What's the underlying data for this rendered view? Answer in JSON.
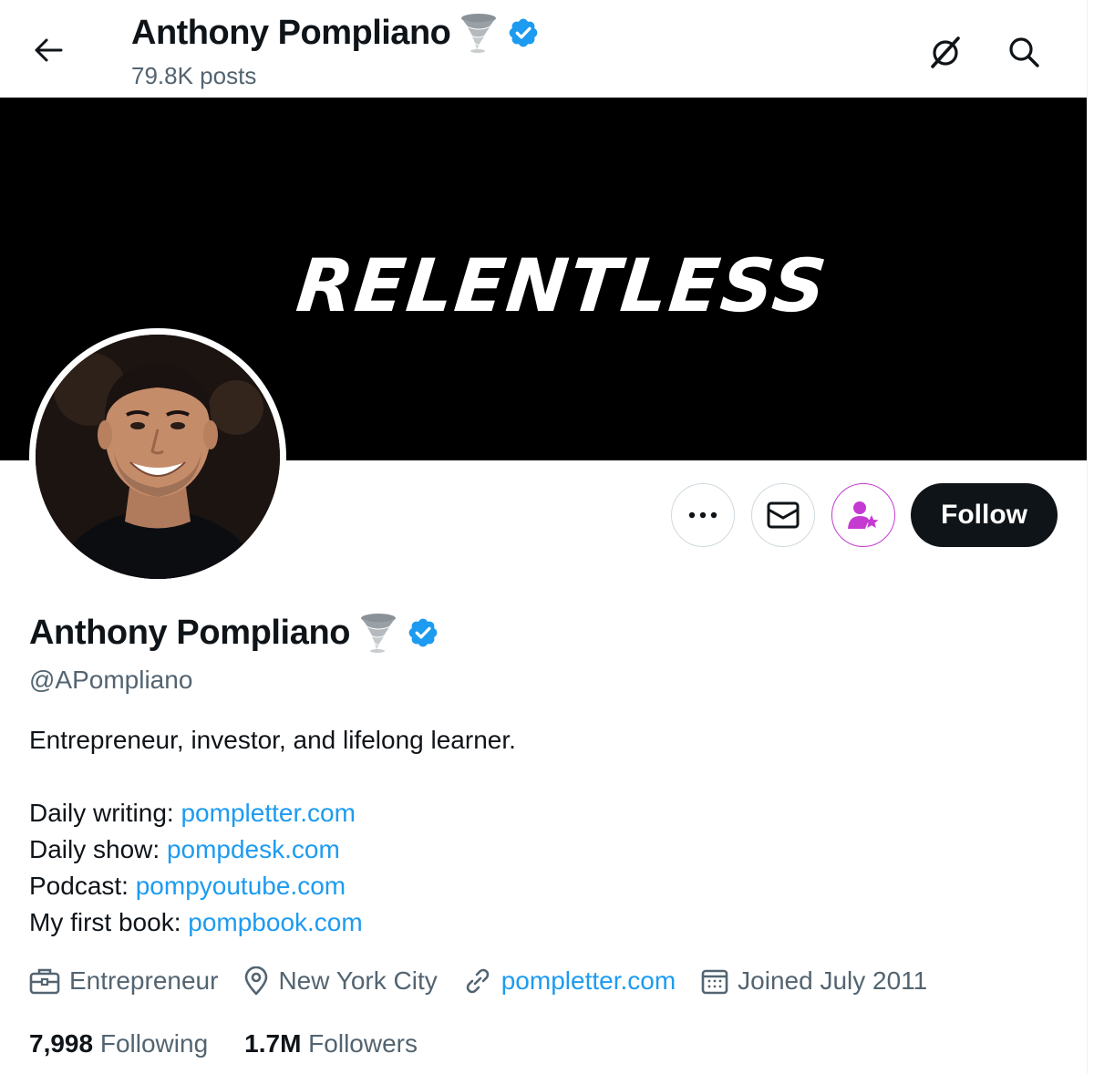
{
  "header": {
    "name": "Anthony Pompliano",
    "posts": "79.8K posts"
  },
  "banner": {
    "text": "RELENTLESS"
  },
  "actions": {
    "follow_label": "Follow"
  },
  "profile": {
    "name": "Anthony Pompliano",
    "handle": "@APompliano",
    "bio": {
      "tagline": "Entrepreneur, investor, and lifelong learner.",
      "links": [
        {
          "label": "Daily writing: ",
          "url": "pompletter.com"
        },
        {
          "label": "Daily show: ",
          "url": "pompdesk.com"
        },
        {
          "label": "Podcast: ",
          "url": "pompyoutube.com"
        },
        {
          "label": "My first book: ",
          "url": "pompbook.com"
        }
      ]
    },
    "meta": {
      "profession": "Entrepreneur",
      "location": "New York City",
      "website": "pompletter.com",
      "joined": "Joined July 2011"
    },
    "stats": {
      "following_count": "7,998",
      "following_label": "Following",
      "followers_count": "1.7M",
      "followers_label": "Followers"
    }
  },
  "icons": {
    "back": "arrow-left-icon",
    "grok": "grok-icon",
    "search": "search-icon",
    "more": "more-icon",
    "message": "mail-icon",
    "subscribe": "subscribe-icon",
    "verified": "verified-badge-icon",
    "tornado": "tornado-emoji-icon",
    "profession": "briefcase-icon",
    "location": "location-pin-icon",
    "website": "link-icon",
    "joined": "calendar-icon"
  },
  "colors": {
    "link": "#1d9bf0",
    "secondary_text": "#536471",
    "follow_button_bg": "#0f1419",
    "subscribe_accent": "#c53bd1"
  }
}
